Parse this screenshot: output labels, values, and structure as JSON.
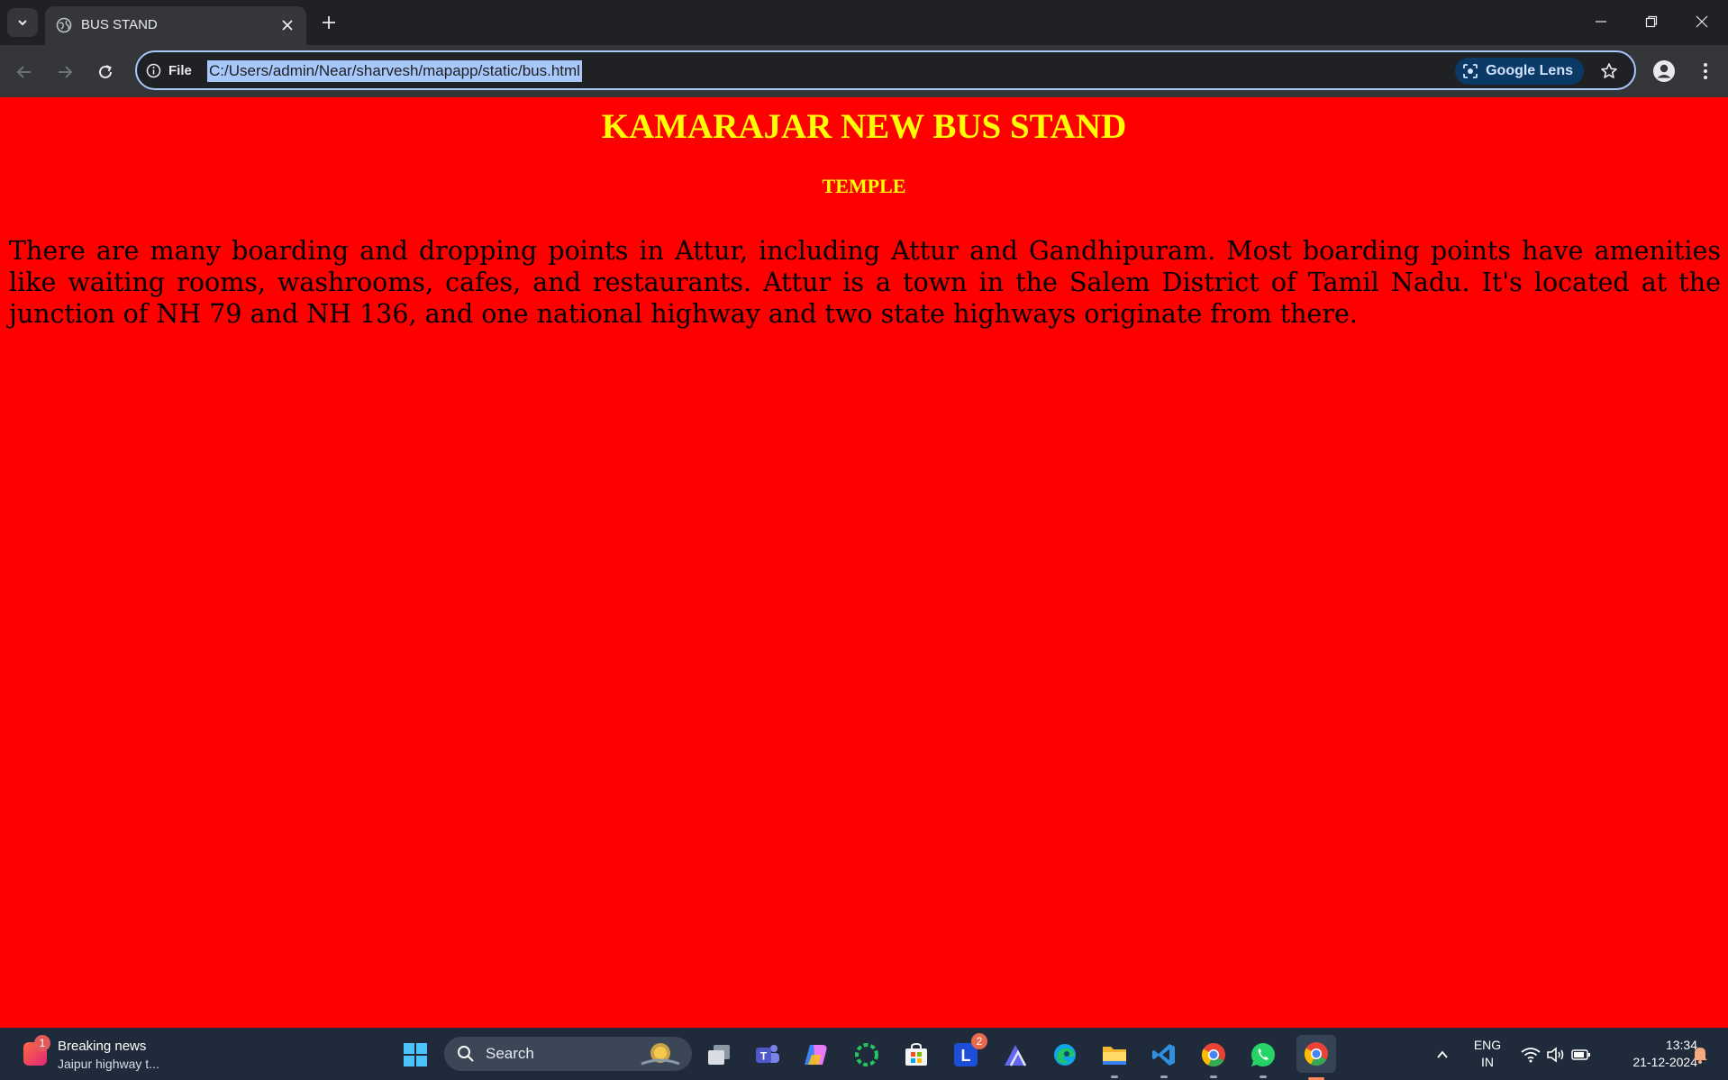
{
  "browser": {
    "tab": {
      "title": "BUS STAND"
    },
    "address_bar": {
      "scheme_label": "File",
      "url": "C:/Users/admin/Near/sharvesh/mapapp/static/bus.html",
      "lens_label": "Google Lens"
    }
  },
  "page": {
    "title": "KAMARAJAR NEW BUS STAND",
    "subtitle": "TEMPLE",
    "paragraph": "There are many boarding and dropping points in Attur, including Attur and Gandhipuram. Most boarding points have amenities like waiting rooms, washrooms, cafes, and restaurants. Attur is a town in the Salem District of Tamil Nadu. It's located at the junction of NH 79 and NH 136, and one national highway and two state highways originate from there.",
    "background_color": "#ff0000",
    "heading_color": "#ffff00",
    "text_color": "#000000"
  },
  "taskbar": {
    "news": {
      "title": "Breaking news",
      "subtitle": "Jaipur highway t...",
      "badge": "1"
    },
    "search_label": "Search",
    "pinned": [
      {
        "icon": "start-icon"
      },
      {
        "icon": "task-view-icon"
      },
      {
        "icon": "teams-icon"
      },
      {
        "icon": "copilot-icon"
      },
      {
        "icon": "circular-app-icon"
      },
      {
        "icon": "store-icon"
      },
      {
        "icon": "l-app-icon",
        "badge": "2"
      },
      {
        "icon": "mountain-app-icon"
      },
      {
        "icon": "edge-icon"
      },
      {
        "icon": "file-explorer-icon"
      },
      {
        "icon": "vscode-icon"
      },
      {
        "icon": "chrome-icon"
      },
      {
        "icon": "whatsapp-icon"
      },
      {
        "icon": "chrome-active-icon"
      }
    ],
    "tray": {
      "language_line1": "ENG",
      "language_line2": "IN",
      "time": "13:34",
      "date": "21-12-2024"
    }
  }
}
